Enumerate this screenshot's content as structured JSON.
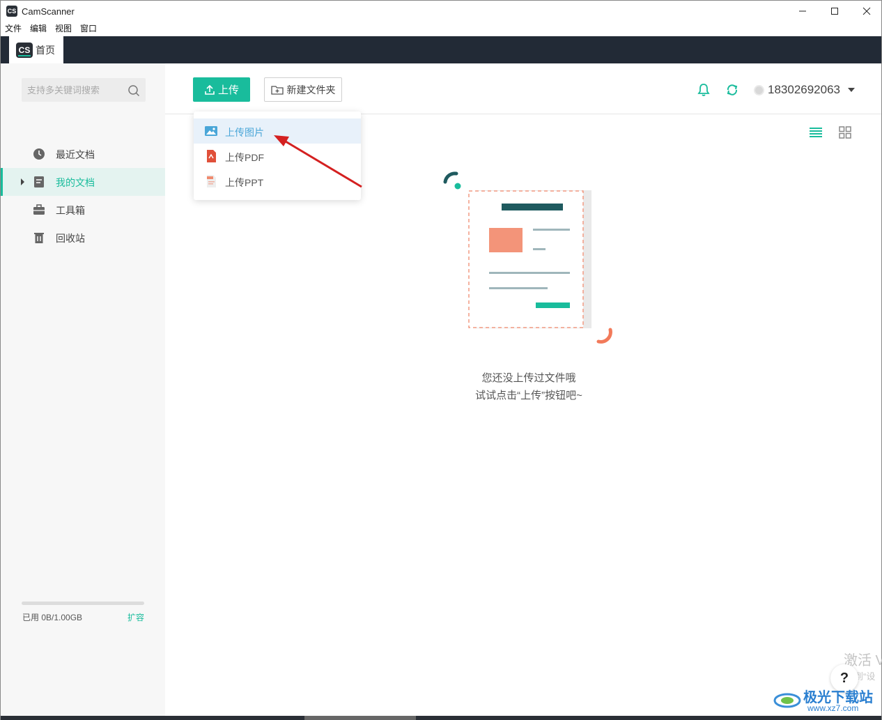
{
  "app": {
    "title": "CamScanner",
    "icon_text": "CS"
  },
  "menu": [
    "文件",
    "编辑",
    "视图",
    "窗口"
  ],
  "tab": {
    "logo_text": "CS",
    "label": "首页"
  },
  "sidebar": {
    "search_placeholder": "支持多关键词搜索",
    "items": [
      {
        "label": "最近文档",
        "icon": "clock-icon"
      },
      {
        "label": "我的文档",
        "icon": "document-icon",
        "active": true
      },
      {
        "label": "工具箱",
        "icon": "toolbox-icon"
      },
      {
        "label": "回收站",
        "icon": "trash-icon"
      }
    ],
    "storage": {
      "used_text": "已用 0B/1.00GB",
      "used_fraction": 0,
      "expand_label": "扩容"
    }
  },
  "toolbar": {
    "upload_label": "上传",
    "new_folder_label": "新建文件夹",
    "user_phone": "18302692063"
  },
  "dropdown": {
    "items": [
      {
        "label": "上传图片",
        "icon": "image-icon",
        "active": true
      },
      {
        "label": "上传PDF",
        "icon": "pdf-icon"
      },
      {
        "label": "上传PPT",
        "icon": "ppt-icon"
      }
    ]
  },
  "empty_state": {
    "line1": "您还没上传过文件哦",
    "line2": "试试点击“上传”按钮吧~"
  },
  "overlay": {
    "activate_line1": "激活 V",
    "activate_line2": "转到“设",
    "help_label": "?",
    "watermark_title": "极光下载站",
    "watermark_url": "www.xz7.com"
  },
  "colors": {
    "accent": "#19bc9c",
    "tabbar": "#222a36",
    "highlight_text": "#4aa6d8",
    "arrow": "#d42020"
  }
}
